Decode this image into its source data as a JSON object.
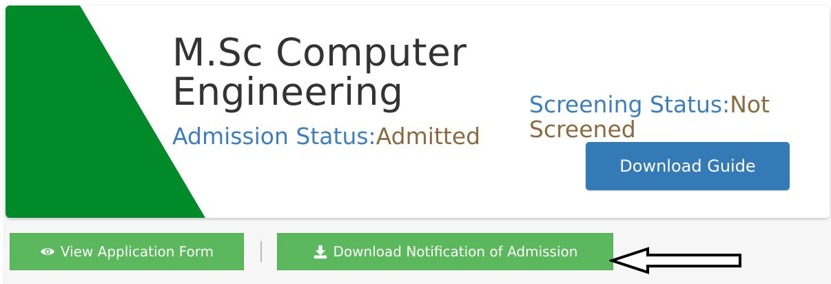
{
  "program": {
    "title": "M.Sc Computer Engineering"
  },
  "admission": {
    "label": "Admission Status:",
    "value": "Admitted"
  },
  "screening": {
    "label": "Screening Status:",
    "value": "Not Screened"
  },
  "buttons": {
    "download_guide": "Download Guide",
    "view_application": "View Application Form",
    "download_notification": "Download Notification of Admission"
  },
  "icons": {
    "view_application": "eye-icon",
    "download_notification": "download-icon",
    "annotation": "left-arrow-icon"
  },
  "colors": {
    "wedge_green": "#008a2a",
    "status_label": "#3a7fc1",
    "status_value": "#8b6a3e",
    "primary_button": "#337ab7",
    "success_button": "#5cb85c"
  }
}
